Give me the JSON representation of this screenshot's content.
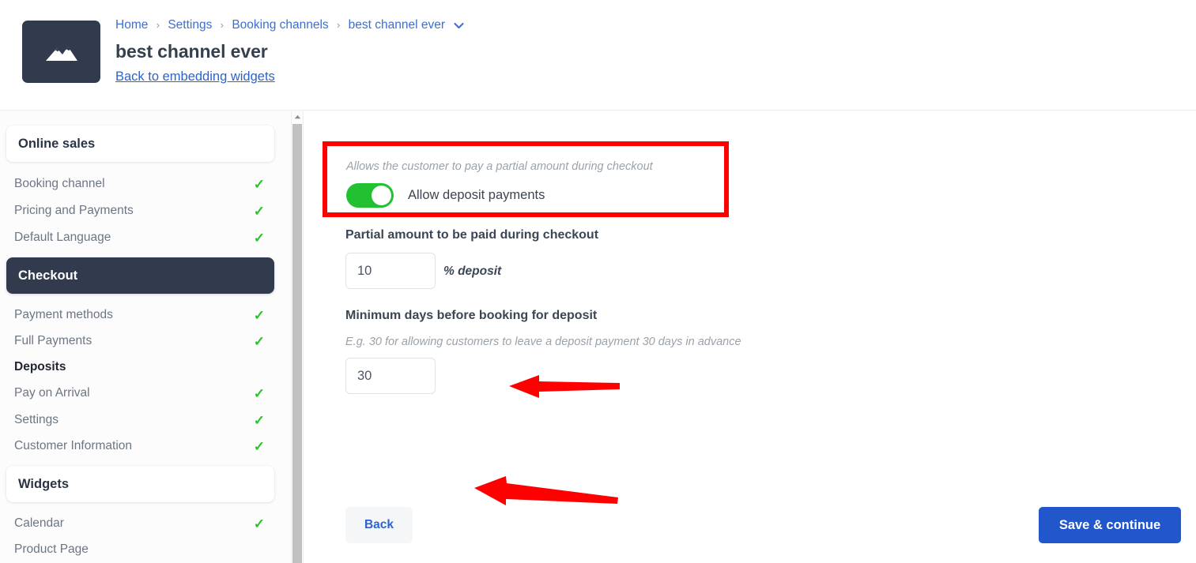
{
  "header": {
    "logo_icon": "mountain-icon",
    "breadcrumb": {
      "items": [
        "Home",
        "Settings",
        "Booking channels",
        "best channel ever"
      ],
      "separator": "›",
      "chevron_icon": "chevron-down-icon"
    },
    "title": "best channel ever",
    "back_link": "Back to embedding widgets"
  },
  "sidebar": {
    "sections": [
      {
        "type": "card",
        "label": "Online sales",
        "active": false
      },
      {
        "type": "item",
        "label": "Booking channel",
        "checked": true,
        "bold": false
      },
      {
        "type": "item",
        "label": "Pricing and Payments",
        "checked": true,
        "bold": false
      },
      {
        "type": "item",
        "label": "Default Language",
        "checked": true,
        "bold": false
      },
      {
        "type": "card",
        "label": "Checkout",
        "active": true
      },
      {
        "type": "item",
        "label": "Payment methods",
        "checked": true,
        "bold": false
      },
      {
        "type": "item",
        "label": "Full Payments",
        "checked": true,
        "bold": false
      },
      {
        "type": "item",
        "label": "Deposits",
        "checked": false,
        "bold": true
      },
      {
        "type": "item",
        "label": "Pay on Arrival",
        "checked": true,
        "bold": false
      },
      {
        "type": "item",
        "label": "Settings",
        "checked": true,
        "bold": false
      },
      {
        "type": "item",
        "label": "Customer Information",
        "checked": true,
        "bold": false
      },
      {
        "type": "card",
        "label": "Widgets",
        "active": false
      },
      {
        "type": "item",
        "label": "Calendar",
        "checked": true,
        "bold": false
      },
      {
        "type": "item",
        "label": "Product Page",
        "checked": false,
        "bold": false
      }
    ],
    "check_glyph": "✓",
    "scrollbar": {
      "up_arrow_icon": "scroll-up-arrow-icon"
    }
  },
  "main": {
    "deposit_toggle": {
      "hint": "Allows the customer to pay a partial amount during checkout",
      "label": "Allow deposit payments",
      "enabled": true
    },
    "partial_amount": {
      "title": "Partial amount to be paid during checkout",
      "value": "10",
      "placeholder": "",
      "suffix": "% deposit"
    },
    "minimum_days": {
      "title": "Minimum days before booking for deposit",
      "hint": "E.g. 30 for allowing customers to leave a deposit payment 30 days in advance",
      "value": "30",
      "placeholder": ""
    },
    "buttons": {
      "back": "Back",
      "save": "Save & continue"
    }
  },
  "colors": {
    "accent_blue": "#2157ca",
    "link_blue": "#2b64cf",
    "toggle_green": "#22c131",
    "check_green": "#26c52a",
    "dark_navy": "#323b4e",
    "annotation_red": "#fe0000"
  }
}
